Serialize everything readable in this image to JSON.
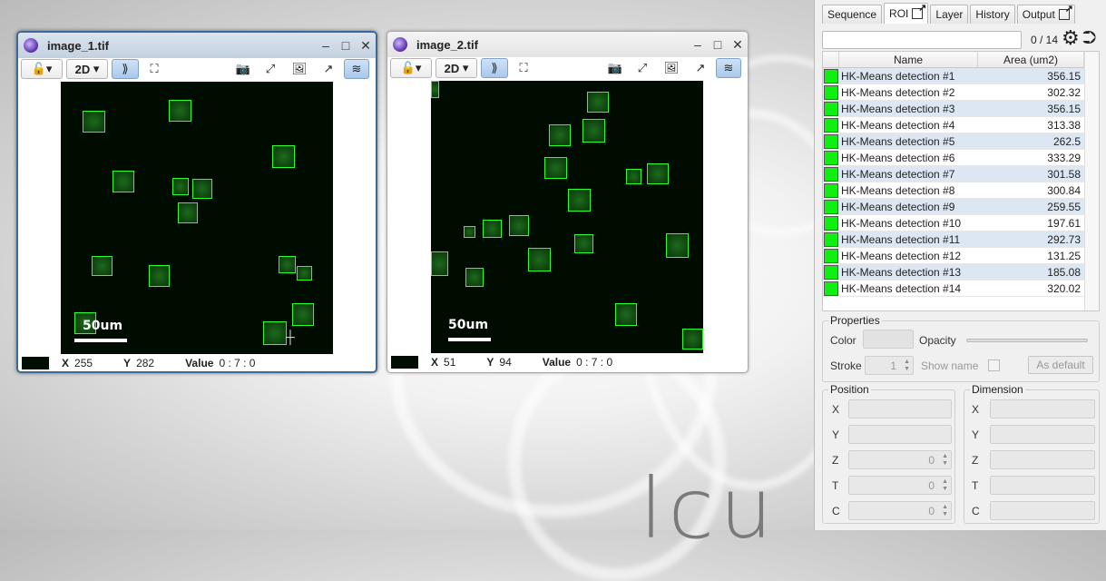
{
  "viewers": [
    {
      "title": "image_1.tif",
      "mode": "2D",
      "scale_label": "50um",
      "status": {
        "x_label": "X",
        "x": "255",
        "y_label": "Y",
        "y": "282",
        "value_label": "Value",
        "value": "0 : 7 : 0"
      }
    },
    {
      "title": "image_2.tif",
      "mode": "2D",
      "scale_label": "50um",
      "status": {
        "x_label": "X",
        "x": "51",
        "y_label": "Y",
        "y": "94",
        "value_label": "Value",
        "value": "0 : 7 : 0"
      }
    }
  ],
  "panel": {
    "tabs": [
      "Sequence",
      "ROI",
      "Layer",
      "History",
      "Output"
    ],
    "active_tab": "ROI",
    "search_placeholder": "",
    "count": "0 / 14",
    "columns": [
      "Name",
      "Area (um2)"
    ],
    "rows": [
      {
        "name": "HK-Means detection #1",
        "area": "356.15"
      },
      {
        "name": "HK-Means detection #2",
        "area": "302.32"
      },
      {
        "name": "HK-Means detection #3",
        "area": "356.15"
      },
      {
        "name": "HK-Means detection #4",
        "area": "313.38"
      },
      {
        "name": "HK-Means detection #5",
        "area": "262.5"
      },
      {
        "name": "HK-Means detection #6",
        "area": "333.29"
      },
      {
        "name": "HK-Means detection #7",
        "area": "301.58"
      },
      {
        "name": "HK-Means detection #8",
        "area": "300.84"
      },
      {
        "name": "HK-Means detection #9",
        "area": "259.55"
      },
      {
        "name": "HK-Means detection #10",
        "area": "197.61"
      },
      {
        "name": "HK-Means detection #11",
        "area": "292.73"
      },
      {
        "name": "HK-Means detection #12",
        "area": "131.25"
      },
      {
        "name": "HK-Means detection #13",
        "area": "185.08"
      },
      {
        "name": "HK-Means detection #14",
        "area": "320.02"
      }
    ],
    "properties": {
      "title": "Properties",
      "color_label": "Color",
      "opacity_label": "Opacity",
      "stroke_label": "Stroke",
      "stroke_value": "1",
      "show_name_label": "Show name",
      "default_button": "As default"
    },
    "position": {
      "title": "Position",
      "labels": [
        "X",
        "Y",
        "Z",
        "T",
        "C"
      ],
      "values": [
        "",
        "",
        "0",
        "0",
        "0"
      ]
    },
    "dimension": {
      "title": "Dimension",
      "labels": [
        "X",
        "Y",
        "Z",
        "T",
        "C"
      ]
    }
  },
  "colors": {
    "roi": "#2bff2b",
    "roi_swatch": "#11ee11",
    "active_title": "#3c6a96"
  },
  "icons": [
    "lock-icon",
    "sync-icon",
    "fit-icon",
    "camera-icon",
    "capture-icon",
    "gallery-icon",
    "external-icon",
    "layers-icon",
    "gear-icon",
    "export-icon"
  ]
}
